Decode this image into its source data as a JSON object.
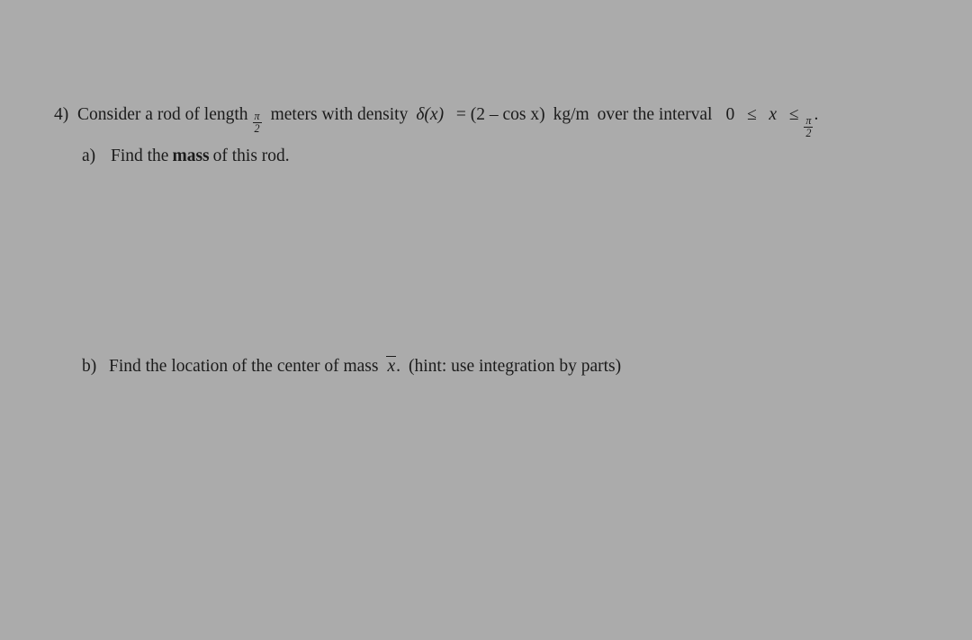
{
  "page": {
    "background_color": "#ababab",
    "text_color": "#1b1b1b"
  },
  "problem": {
    "number": "4)",
    "statement": {
      "text_before_length": "Consider a rod of length",
      "length_value": {
        "numerator": "π",
        "denominator": "2"
      },
      "text_after_length": "meters with density",
      "density_symbol": "δ",
      "density_argument": "(x)",
      "equals": "=",
      "density_expression": "(2 – cos x)",
      "units": "kg/m",
      "text_before_interval": "over the interval",
      "interval": {
        "lower": "0",
        "first_relation": "≤",
        "variable": "x",
        "second_relation": "≤",
        "upper": {
          "numerator": "π",
          "denominator": "2"
        }
      },
      "terminator": "."
    },
    "parts": [
      {
        "marker": "a)",
        "text_before_emphasis": "Find the",
        "emphasis": "mass",
        "text_after_emphasis": "of this rod."
      },
      {
        "marker": "b)",
        "text_before_symbol": "Find the location of the center of mass",
        "symbol": "x",
        "symbol_decoration": "overbar",
        "text_after_symbol": ".",
        "hint": "(hint: use integration by parts)"
      }
    ]
  }
}
